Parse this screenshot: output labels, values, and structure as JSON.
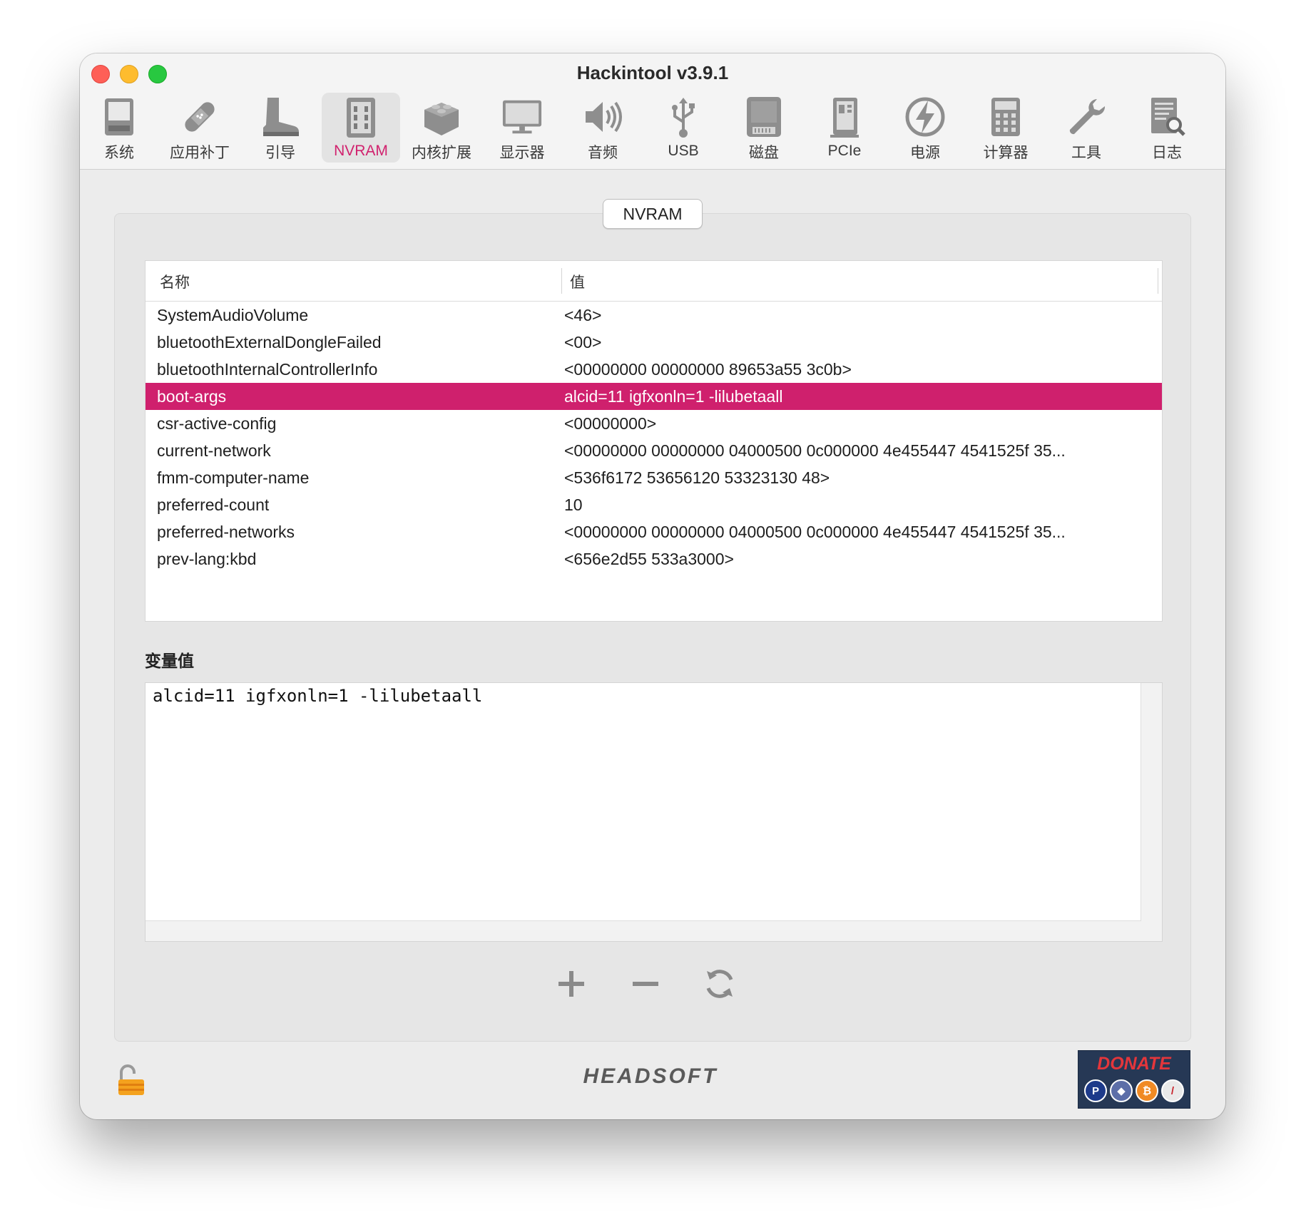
{
  "window": {
    "title": "Hackintool v3.9.1"
  },
  "toolbar": {
    "items": [
      {
        "label": "系统",
        "icon": "computer-icon"
      },
      {
        "label": "应用补丁",
        "icon": "bandage-icon"
      },
      {
        "label": "引导",
        "icon": "boot-icon"
      },
      {
        "label": "NVRAM",
        "icon": "memory-chip-icon"
      },
      {
        "label": "内核扩展",
        "icon": "lego-brick-icon"
      },
      {
        "label": "显示器",
        "icon": "monitor-icon"
      },
      {
        "label": "音频",
        "icon": "speaker-icon"
      },
      {
        "label": "USB",
        "icon": "usb-icon"
      },
      {
        "label": "磁盘",
        "icon": "disk-icon"
      },
      {
        "label": "PCIe",
        "icon": "pcie-card-icon"
      },
      {
        "label": "电源",
        "icon": "power-bolt-icon"
      },
      {
        "label": "计算器",
        "icon": "calculator-icon"
      },
      {
        "label": "工具",
        "icon": "wrench-icon"
      },
      {
        "label": "日志",
        "icon": "log-document-icon"
      }
    ],
    "selected": "NVRAM",
    "accent_color": "#d1226e"
  },
  "panel": {
    "tab_label": "NVRAM"
  },
  "table": {
    "columns": [
      "名称",
      "值"
    ],
    "rows": [
      {
        "name": "SystemAudioVolume",
        "value": "<46>"
      },
      {
        "name": "bluetoothExternalDongleFailed",
        "value": "<00>"
      },
      {
        "name": "bluetoothInternalControllerInfo",
        "value": "<00000000 00000000 89653a55 3c0b>"
      },
      {
        "name": "boot-args",
        "value": "alcid=11 igfxonln=1 -lilubetaall"
      },
      {
        "name": "csr-active-config",
        "value": "<00000000>"
      },
      {
        "name": "current-network",
        "value": "<00000000 00000000 04000500 0c000000 4e455447 4541525f 35..."
      },
      {
        "name": "fmm-computer-name",
        "value": "<536f6172 53656120 53323130 48>"
      },
      {
        "name": "preferred-count",
        "value": "10"
      },
      {
        "name": "preferred-networks",
        "value": "<00000000 00000000 04000500 0c000000 4e455447 4541525f 35..."
      },
      {
        "name": "prev-lang:kbd",
        "value": "<656e2d55 533a3000>"
      }
    ],
    "selected_row": "boot-args",
    "selected_color": "#cf206d"
  },
  "variable": {
    "label": "变量值",
    "value": "alcid=11 igfxonln=1 -lilubetaall"
  },
  "actions": [
    {
      "name": "add-button",
      "icon": "plus-icon"
    },
    {
      "name": "remove-button",
      "icon": "minus-icon"
    },
    {
      "name": "refresh-button",
      "icon": "refresh-icon"
    }
  ],
  "footer": {
    "brand": "HEADSOFT",
    "donate_label": "DONATE",
    "lock_icon": "unlocked-padlock-icon",
    "donate_coins": [
      "paypal-icon",
      "ethereum-icon",
      "bitcoin-icon",
      "other-coin-icon"
    ]
  }
}
